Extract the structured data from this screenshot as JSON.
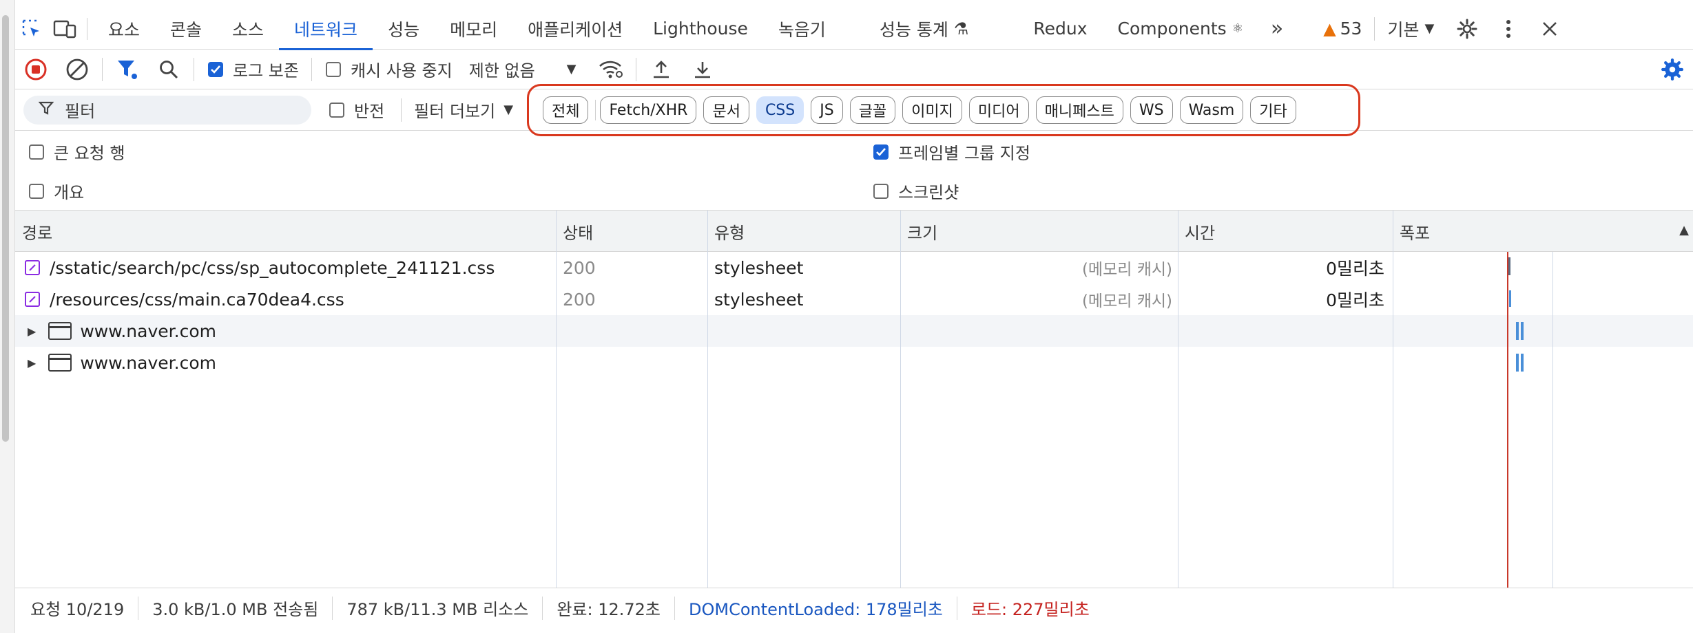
{
  "main_tabs": [
    {
      "label": "요소"
    },
    {
      "label": "콘솔"
    },
    {
      "label": "소스"
    },
    {
      "label": "네트워크"
    },
    {
      "label": "성능"
    },
    {
      "label": "메모리"
    },
    {
      "label": "애플리케이션"
    },
    {
      "label": "Lighthouse"
    },
    {
      "label": "녹음기"
    },
    {
      "label": "성능 통계"
    },
    {
      "label": "Redux"
    },
    {
      "label": "Components"
    }
  ],
  "active_tab": "네트워크",
  "issues_count": "53",
  "preset_label": "기본",
  "toolbar": {
    "preserve_log_label": "로그 보존",
    "disable_cache_label": "캐시 사용 중지",
    "throttling_value": "제한 없음"
  },
  "filter": {
    "placeholder": "필터",
    "invert_label": "반전",
    "more_filters_label": "필터 더보기",
    "types": [
      "전체",
      "Fetch/XHR",
      "문서",
      "CSS",
      "JS",
      "글꼴",
      "이미지",
      "미디어",
      "매니페스트",
      "WS",
      "Wasm",
      "기타"
    ],
    "active_type": "CSS"
  },
  "options": {
    "big_rows_label": "큰 요청 행",
    "overview_label": "개요",
    "group_by_frame_label": "프레임별 그룹 지정",
    "screenshots_label": "스크린샷"
  },
  "columns": {
    "name": "경로",
    "status": "상태",
    "type": "유형",
    "size": "크기",
    "time": "시간",
    "waterfall": "폭포"
  },
  "rows": [
    {
      "name": "/sstatic/search/pc/css/sp_autocomplete_241121.css",
      "status": "200",
      "type": "stylesheet",
      "size": "(메모리 캐시)",
      "time": "0밀리초"
    },
    {
      "name": "/resources/css/main.ca70dea4.css",
      "status": "200",
      "type": "stylesheet",
      "size": "(메모리 캐시)",
      "time": "0밀리초"
    }
  ],
  "frame_groups": [
    {
      "name": "www.naver.com"
    },
    {
      "name": "www.naver.com"
    }
  ],
  "status_bar": {
    "requests": "요청 10/219",
    "transferred": "3.0 kB/1.0 MB 전송됨",
    "resources": "787 kB/11.3 MB 리소스",
    "finish": "완료: 12.72초",
    "dom_content_loaded": "DOMContentLoaded: 178밀리초",
    "load": "로드: 227밀리초"
  },
  "colors": {
    "accent": "#1a62d6",
    "highlight_outline": "#d9381e",
    "record_stop": "#d93025",
    "load_red": "#c5221f",
    "dcl_blue": "#1a57c0"
  }
}
